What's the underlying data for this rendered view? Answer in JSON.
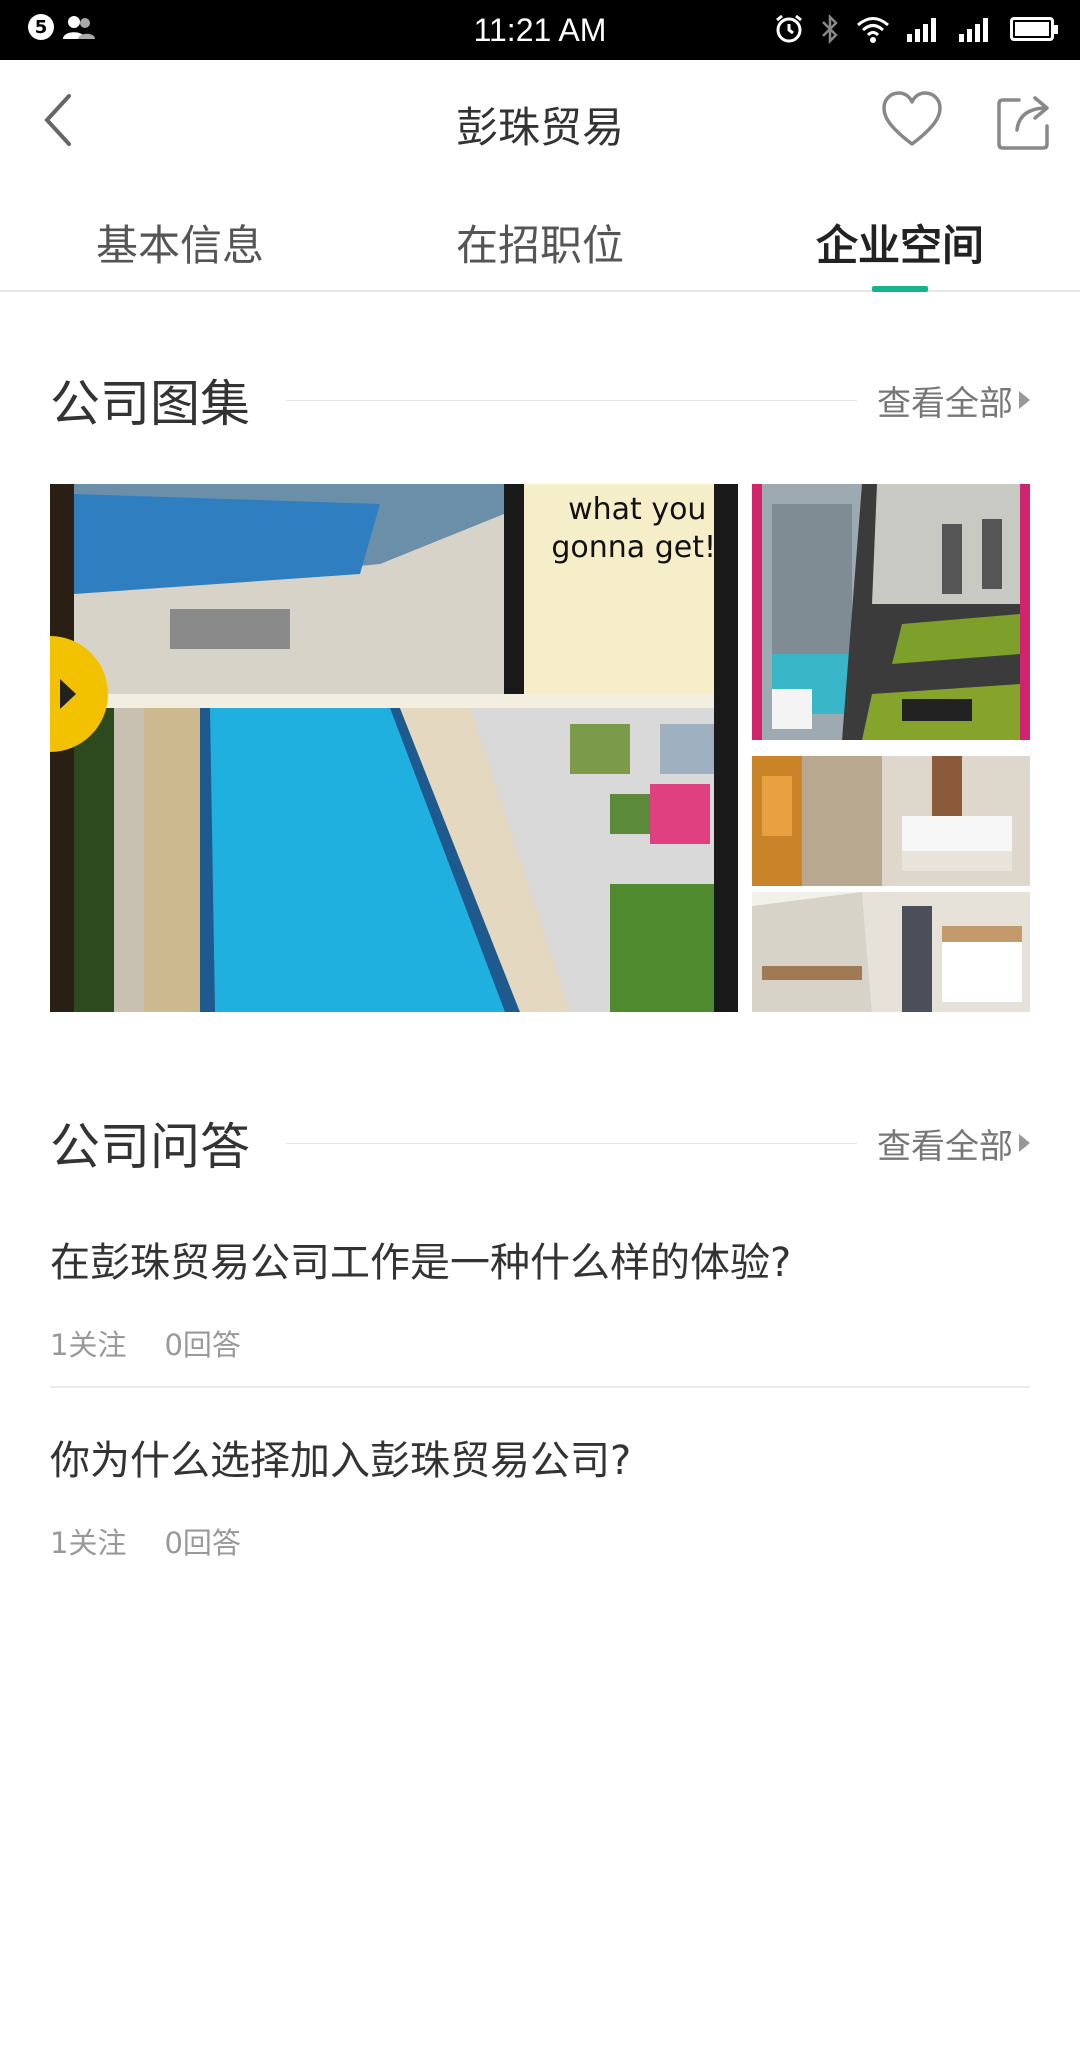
{
  "status_bar": {
    "notification_count": "5",
    "time": "11:21 AM"
  },
  "navbar": {
    "title": "彭珠贸易"
  },
  "tabs": [
    {
      "label": "基本信息",
      "active": false
    },
    {
      "label": "在招职位",
      "active": false
    },
    {
      "label": "企业空间",
      "active": true
    }
  ],
  "gallery": {
    "title": "公司图集",
    "view_all": "查看全部",
    "main_photo_text": "what you gonna get!"
  },
  "qa": {
    "title": "公司问答",
    "view_all": "查看全部",
    "items": [
      {
        "question": "在彭珠贸易公司工作是一种什么样的体验?",
        "follows": "1关注",
        "answers": "0回答"
      },
      {
        "question": "你为什么选择加入彭珠贸易公司?",
        "follows": "1关注",
        "answers": "0回答"
      }
    ]
  },
  "colors": {
    "accent": "#19b48c",
    "statusbar_bg": "#000000"
  }
}
